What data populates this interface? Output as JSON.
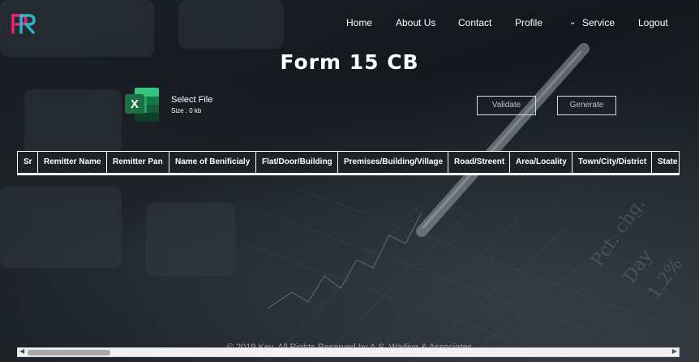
{
  "nav": {
    "items": [
      "Home",
      "About Us",
      "Contact",
      "Profile",
      "Service",
      "Logout"
    ]
  },
  "page": {
    "title": "Form 15 CB"
  },
  "upload": {
    "label": "Select File",
    "size": "Size : 0 kb",
    "icon": "excel-file-icon"
  },
  "actions": {
    "validate": "Validate",
    "generate": "Generate"
  },
  "table": {
    "columns": [
      "Sr",
      "Remitter Name",
      "Remitter Pan",
      "Name of Benificialy",
      "Flat/Door/Building",
      "Premises/Building/Village",
      "Road/Streent",
      "Area/Locality",
      "Town/City/District",
      "State"
    ]
  },
  "footer": {
    "text": "© 2019 Key. All Rights Reserved by A.S. Wadiya & Associates"
  },
  "colors": {
    "logo_pink": "#e8227a",
    "logo_cyan": "#2ec4d6",
    "excel_green": "#1d7044"
  }
}
